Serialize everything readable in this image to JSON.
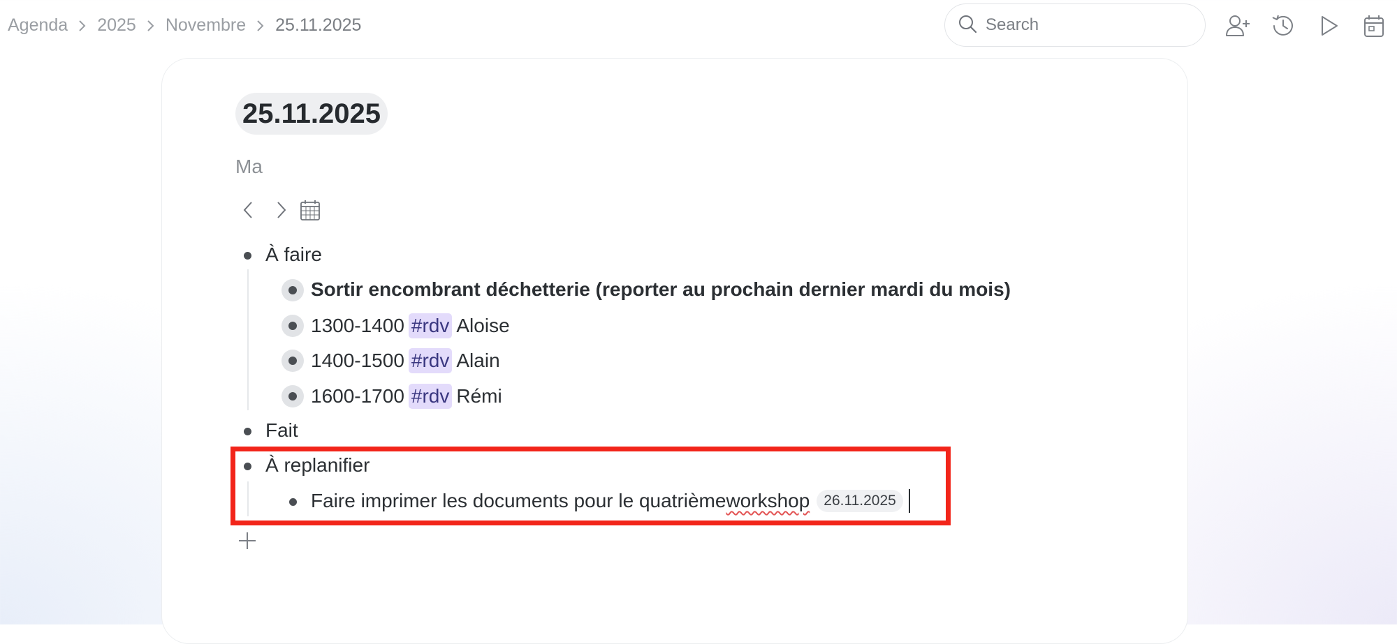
{
  "breadcrumb": {
    "items": [
      "Agenda",
      "2025",
      "Novembre",
      "25.11.2025"
    ]
  },
  "search": {
    "placeholder": "Search"
  },
  "toolbar": {
    "icons": [
      "add-user-icon",
      "history-icon",
      "play-icon",
      "calendar-icon"
    ]
  },
  "page": {
    "title": "25.11.2025",
    "subtitle": "Ma"
  },
  "outline": {
    "todo": {
      "label": "À faire",
      "items": [
        {
          "text": "Sortir encombrant déchetterie (reporter au prochain dernier mardi du mois)"
        },
        {
          "time": "1300-1400",
          "tag": "#rdv",
          "name": "Aloise"
        },
        {
          "time": "1400-1500",
          "tag": "#rdv",
          "name": "Alain"
        },
        {
          "time": "1600-1700",
          "tag": "#rdv",
          "name": "Rémi"
        }
      ]
    },
    "done": {
      "label": "Fait"
    },
    "reschedule": {
      "label": "À replanifier",
      "item": {
        "text_before": "Faire imprimer les documents pour le quatrième ",
        "misspelled": "workshop",
        "date_chip": "26.11.2025"
      }
    }
  },
  "colors": {
    "tag_bg": "#e3dbfb",
    "highlight": "#f2251a",
    "bullet": "#4a4e53"
  }
}
